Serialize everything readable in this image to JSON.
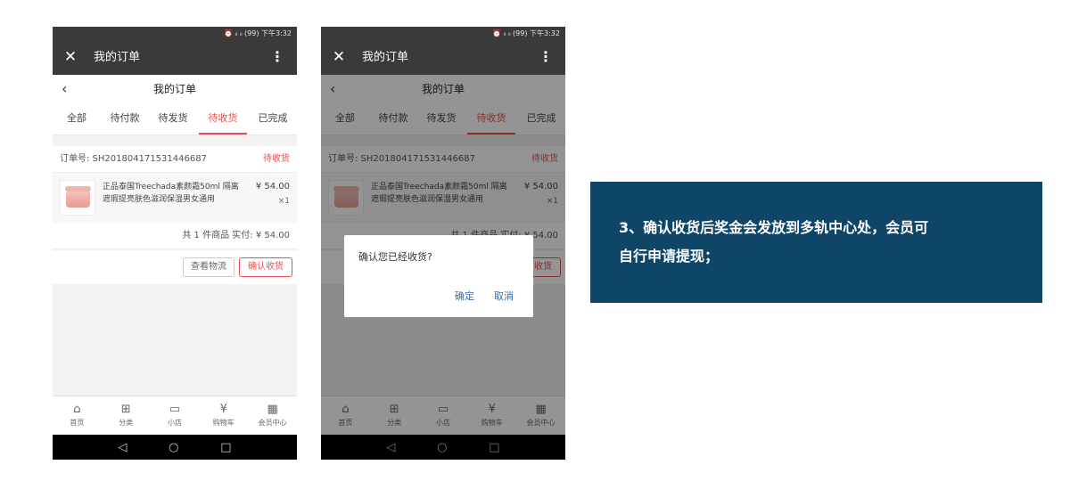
{
  "status_bar": {
    "time": "⏰ ᵢₗ ᵢₗ (99) 下午3:32"
  },
  "app_bar": {
    "close_icon": "close-icon",
    "title": "我的订单",
    "more_icon": "more-vertical-icon"
  },
  "page_header": {
    "back_icon": "chevron-left-icon",
    "title": "我的订单"
  },
  "tabs": [
    {
      "label": "全部",
      "active": false
    },
    {
      "label": "待付款",
      "active": false
    },
    {
      "label": "待发货",
      "active": false
    },
    {
      "label": "待收货",
      "active": true
    },
    {
      "label": "已完成",
      "active": false
    }
  ],
  "order": {
    "number_label": "订单号: SH201804171531446687",
    "status": "待收货",
    "product": {
      "name": "正品泰国Treechada素颜霜50ml 隔离遮瑕提亮肤色滋润保湿男女通用",
      "price": "¥ 54.00",
      "qty": "×1"
    },
    "summary": "共 1 件商品  实付: ¥ 54.00",
    "track_button": "查看物流",
    "confirm_button": "确认收货"
  },
  "tab_bar": [
    {
      "icon": "shop-icon",
      "label": "首页"
    },
    {
      "icon": "grid-icon",
      "label": "分类"
    },
    {
      "icon": "store-icon",
      "label": "小店"
    },
    {
      "icon": "cart-icon",
      "label": "购物车"
    },
    {
      "icon": "qr-icon",
      "label": "会员中心"
    }
  ],
  "dialog": {
    "message": "确认您已经收货?",
    "ok": "确定",
    "cancel": "取消"
  },
  "caption": {
    "line1": "3、确认收货后奖金会发放到多轨中心处，会员可",
    "line2": "自行申请提现；"
  },
  "colors": {
    "accent": "#e8504f",
    "appbar": "#3a3a3a",
    "caption_bg": "#0f4566",
    "dialog_button": "#3a6ea5"
  }
}
